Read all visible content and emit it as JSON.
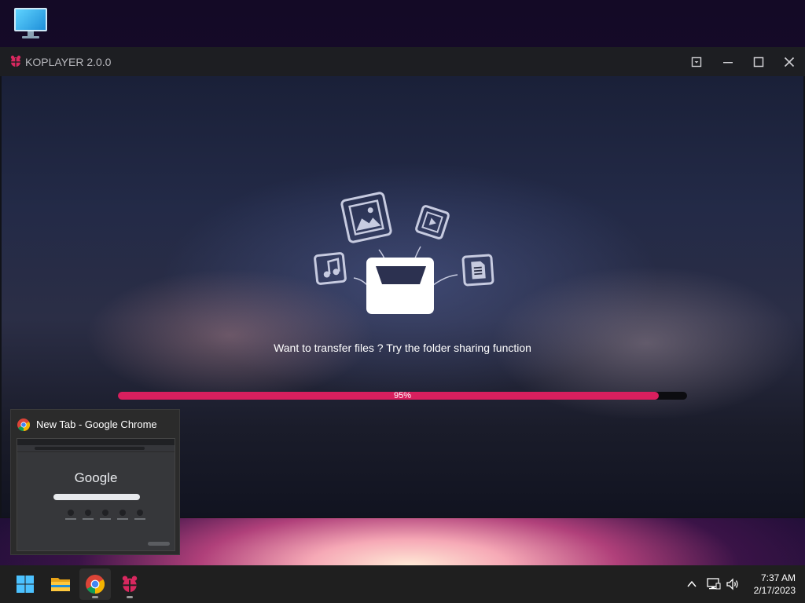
{
  "desktop": {
    "icon": "this-pc-monitor-icon"
  },
  "window": {
    "title": "KOPLAYER 2.0.0",
    "controls": [
      "dropdown-icon",
      "minimize-icon",
      "maximize-icon",
      "close-icon"
    ]
  },
  "content": {
    "message": "Want to transfer files ? Try the folder sharing function",
    "progress": {
      "value": 0.95,
      "label": "95%"
    },
    "colors": {
      "progress_fill": "#d81f5e",
      "progress_track": "#0c0c10"
    }
  },
  "preview": {
    "title": "New Tab - Google Chrome",
    "thumbnail_text": "Google"
  },
  "taskbar": {
    "apps": [
      "windows-start-icon",
      "file-explorer-icon",
      "chrome-icon",
      "koplayer-icon"
    ],
    "tray": [
      "chevron-up-icon",
      "network-icon",
      "volume-icon"
    ],
    "time": "7:37 AM",
    "date": "2/17/2023"
  }
}
